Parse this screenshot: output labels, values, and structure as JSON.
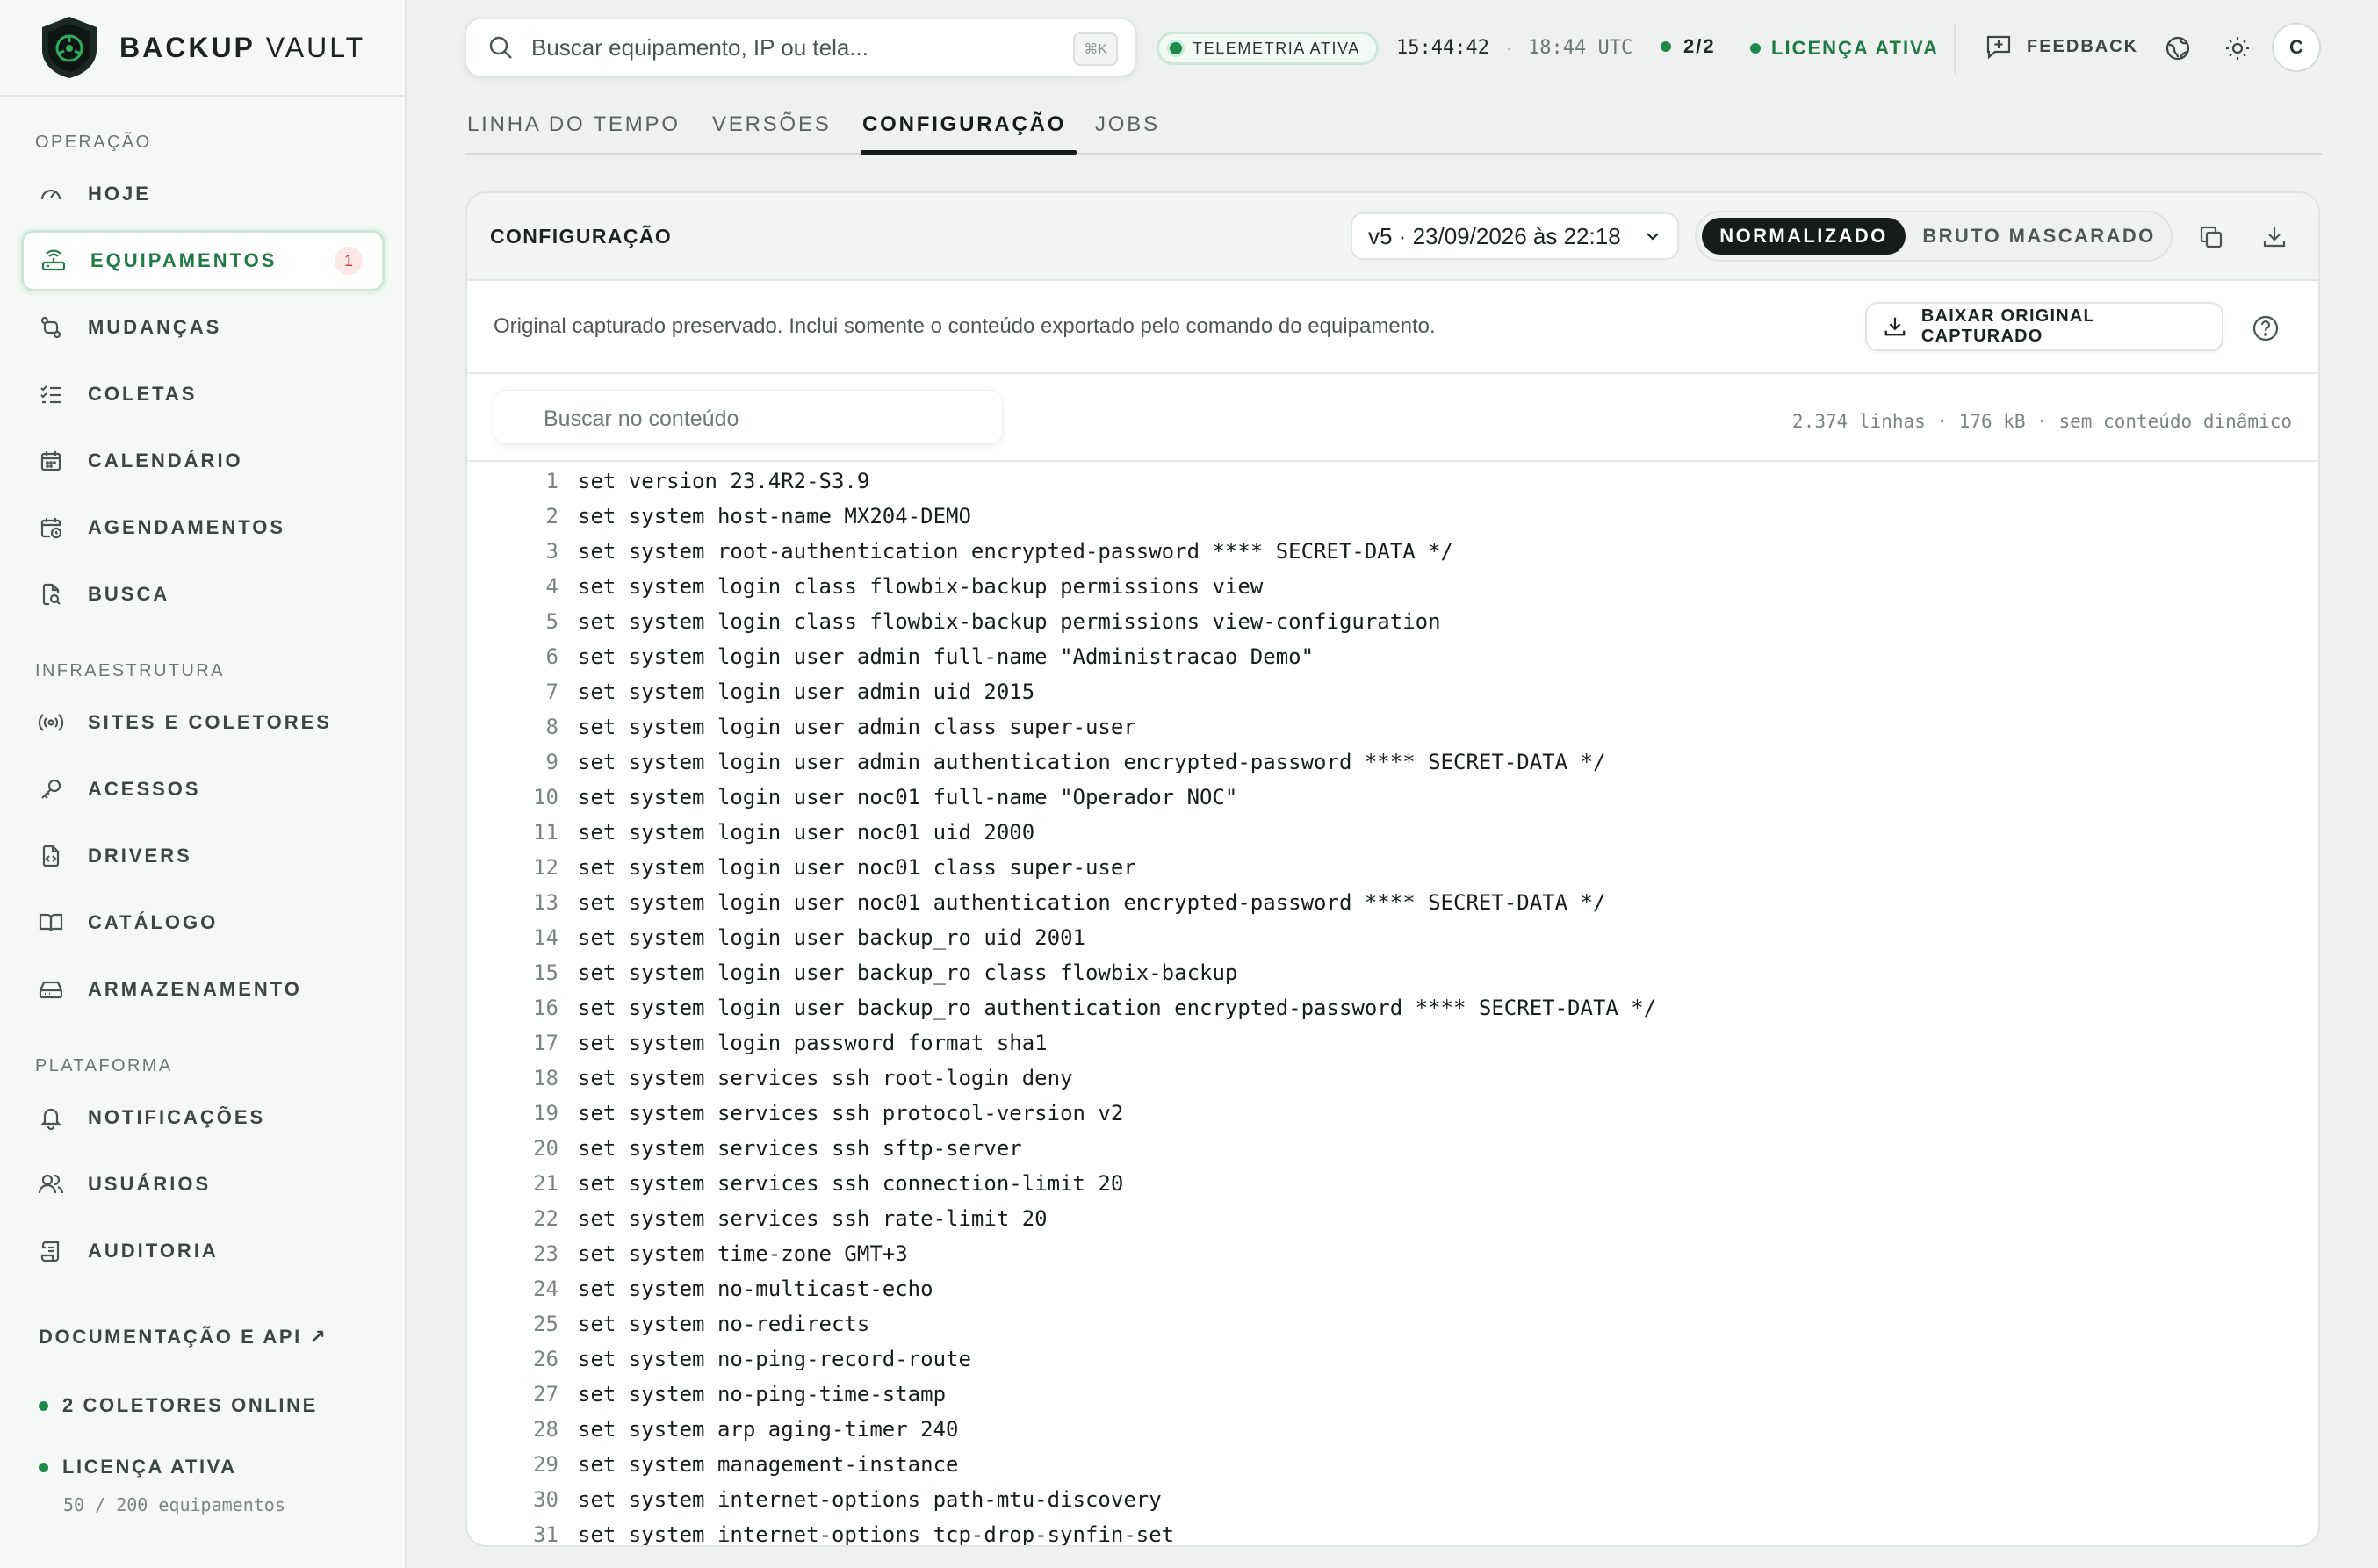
{
  "brand": {
    "bold": "BACKUP",
    "light": "VAULT"
  },
  "sidebar": {
    "sections": [
      {
        "label": "OPERAÇÃO"
      },
      {
        "label": "INFRAESTRUTURA"
      },
      {
        "label": "PLATAFORMA"
      }
    ],
    "items": [
      {
        "label": "HOJE",
        "icon": "gauge-icon"
      },
      {
        "label": "EQUIPAMENTOS",
        "icon": "router-icon",
        "active": true,
        "badge": "1"
      },
      {
        "label": "MUDANÇAS",
        "icon": "git-diff-icon"
      },
      {
        "label": "COLETAS",
        "icon": "list-check-icon"
      },
      {
        "label": "CALENDÁRIO",
        "icon": "calendar-icon"
      },
      {
        "label": "AGENDAMENTOS",
        "icon": "calendar-clock-icon"
      },
      {
        "label": "BUSCA",
        "icon": "file-search-icon"
      },
      {
        "label": "SITES E COLETORES",
        "icon": "radio-icon"
      },
      {
        "label": "ACESSOS",
        "icon": "key-icon"
      },
      {
        "label": "DRIVERS",
        "icon": "file-code-icon"
      },
      {
        "label": "CATÁLOGO",
        "icon": "book-icon"
      },
      {
        "label": "ARMAZENAMENTO",
        "icon": "hard-drive-icon"
      },
      {
        "label": "NOTIFICAÇÕES",
        "icon": "bell-icon"
      },
      {
        "label": "USUÁRIOS",
        "icon": "users-icon"
      },
      {
        "label": "AUDITORIA",
        "icon": "scroll-icon"
      }
    ],
    "docs_link": "DOCUMENTAÇÃO E API ↗",
    "collectors_status": "2 COLETORES ONLINE",
    "license_status": "LICENÇA ATIVA",
    "license_usage": "50 / 200 equipamentos"
  },
  "topbar": {
    "search_placeholder": "Buscar equipamento, IP ou tela...",
    "shortcut": "⌘K",
    "telemetry": "TELEMETRIA ATIVA",
    "local_time": "15:44:42",
    "separator": "·",
    "utc_time": "18:44 UTC",
    "collectors": "2/2",
    "license": "LICENÇA ATIVA",
    "feedback": "FEEDBACK",
    "avatar_initial": "C"
  },
  "tabs": [
    {
      "label": "LINHA DO TEMPO"
    },
    {
      "label": "VERSÕES"
    },
    {
      "label": "CONFIGURAÇÃO",
      "active": true
    },
    {
      "label": "JOBS"
    }
  ],
  "panel": {
    "title": "CONFIGURAÇÃO",
    "version": "v5 · 23/09/2026 às 22:18",
    "mode_active": "NORMALIZADO",
    "mode_other": "BRUTO MASCARADO",
    "info": "Original capturado preservado. Inclui somente o conteúdo exportado pelo comando do equipamento.",
    "download_button": "BAIXAR ORIGINAL CAPTURADO",
    "content_search_placeholder": "Buscar no conteúdo",
    "content_meta": "2.374 linhas · 176 kB · sem conteúdo dinâmico"
  },
  "colors": {
    "accent": "#1f7a45",
    "dark": "#151c19",
    "badge_bg": "#fde8e8",
    "badge_fg": "#c43b3b"
  },
  "config_lines": [
    "set version 23.4R2-S3.9",
    "set system host-name MX204-DEMO",
    "set system root-authentication encrypted-password **** SECRET-DATA */",
    "set system login class flowbix-backup permissions view",
    "set system login class flowbix-backup permissions view-configuration",
    "set system login user admin full-name \"Administracao Demo\"",
    "set system login user admin uid 2015",
    "set system login user admin class super-user",
    "set system login user admin authentication encrypted-password **** SECRET-DATA */",
    "set system login user noc01 full-name \"Operador NOC\"",
    "set system login user noc01 uid 2000",
    "set system login user noc01 class super-user",
    "set system login user noc01 authentication encrypted-password **** SECRET-DATA */",
    "set system login user backup_ro uid 2001",
    "set system login user backup_ro class flowbix-backup",
    "set system login user backup_ro authentication encrypted-password **** SECRET-DATA */",
    "set system login password format sha1",
    "set system services ssh root-login deny",
    "set system services ssh protocol-version v2",
    "set system services ssh sftp-server",
    "set system services ssh connection-limit 20",
    "set system services ssh rate-limit 20",
    "set system time-zone GMT+3",
    "set system no-multicast-echo",
    "set system no-redirects",
    "set system no-ping-record-route",
    "set system no-ping-time-stamp",
    "set system arp aging-timer 240",
    "set system management-instance",
    "set system internet-options path-mtu-discovery",
    "set system internet-options tcp-drop-synfin-set"
  ]
}
